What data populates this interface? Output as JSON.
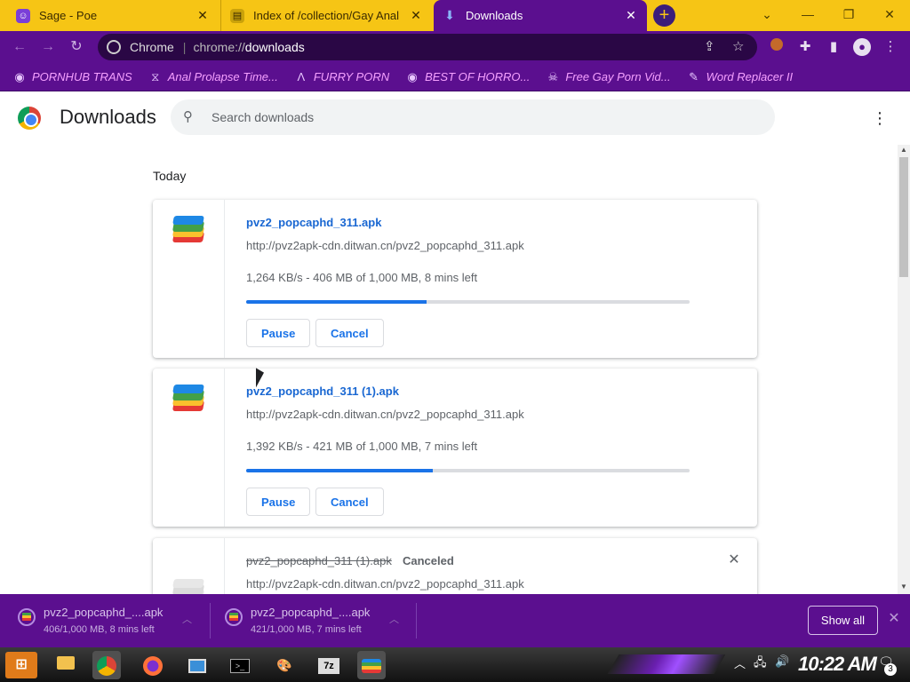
{
  "tabs": [
    {
      "title": "Sage - Poe",
      "close": "✕"
    },
    {
      "title": "Index of /collection/Gay Anal",
      "close": "✕"
    },
    {
      "title": "Downloads",
      "close": "✕"
    }
  ],
  "toolbar": {
    "site_label": "Chrome",
    "url_scheme": "chrome://",
    "url_path": "downloads"
  },
  "bookmarks": [
    {
      "label": "PORNHUB TRANS",
      "icon": "globe-icon"
    },
    {
      "label": "Anal Prolapse Time...",
      "icon": "hourglass-icon"
    },
    {
      "label": "FURRY PORN",
      "icon": "lambda-icon"
    },
    {
      "label": "BEST OF HORRO...",
      "icon": "globe-icon"
    },
    {
      "label": "Free Gay Porn Vid...",
      "icon": "skull-icon"
    },
    {
      "label": "Word Replacer II",
      "icon": "wr-icon"
    }
  ],
  "header": {
    "title": "Downloads",
    "search_placeholder": "Search downloads"
  },
  "section_date": "Today",
  "downloads": [
    {
      "filename": "pvz2_popcaphd_311.apk",
      "url": "http://pvz2apk-cdn.ditwan.cn/pvz2_popcaphd_311.apk",
      "status": "1,264 KB/s - 406 MB of 1,000 MB, 8 mins left",
      "progress": 0.406,
      "pause_label": "Pause",
      "cancel_label": "Cancel"
    },
    {
      "filename": "pvz2_popcaphd_311 (1).apk",
      "url": "http://pvz2apk-cdn.ditwan.cn/pvz2_popcaphd_311.apk",
      "status": "1,392 KB/s - 421 MB of 1,000 MB, 7 mins left",
      "progress": 0.421,
      "pause_label": "Pause",
      "cancel_label": "Cancel"
    },
    {
      "filename": "pvz2_popcaphd_311 (1).apk",
      "url": "http://pvz2apk-cdn.ditwan.cn/pvz2_popcaphd_311.apk",
      "state_label": "Canceled"
    }
  ],
  "shelf": {
    "items": [
      {
        "name": "pvz2_popcaphd_....apk",
        "status": "406/1,000 MB, 8 mins left"
      },
      {
        "name": "pvz2_popcaphd_....apk",
        "status": "421/1,000 MB, 7 mins left"
      }
    ],
    "show_all_label": "Show all"
  },
  "taskbar": {
    "clock": "10:22 AM",
    "notification_count": "3"
  },
  "colors": {
    "tabstrip": "#f6c515",
    "theme_purple": "#5b0f8f",
    "link_blue": "#1967d2",
    "progress_blue": "#1a73e8"
  }
}
